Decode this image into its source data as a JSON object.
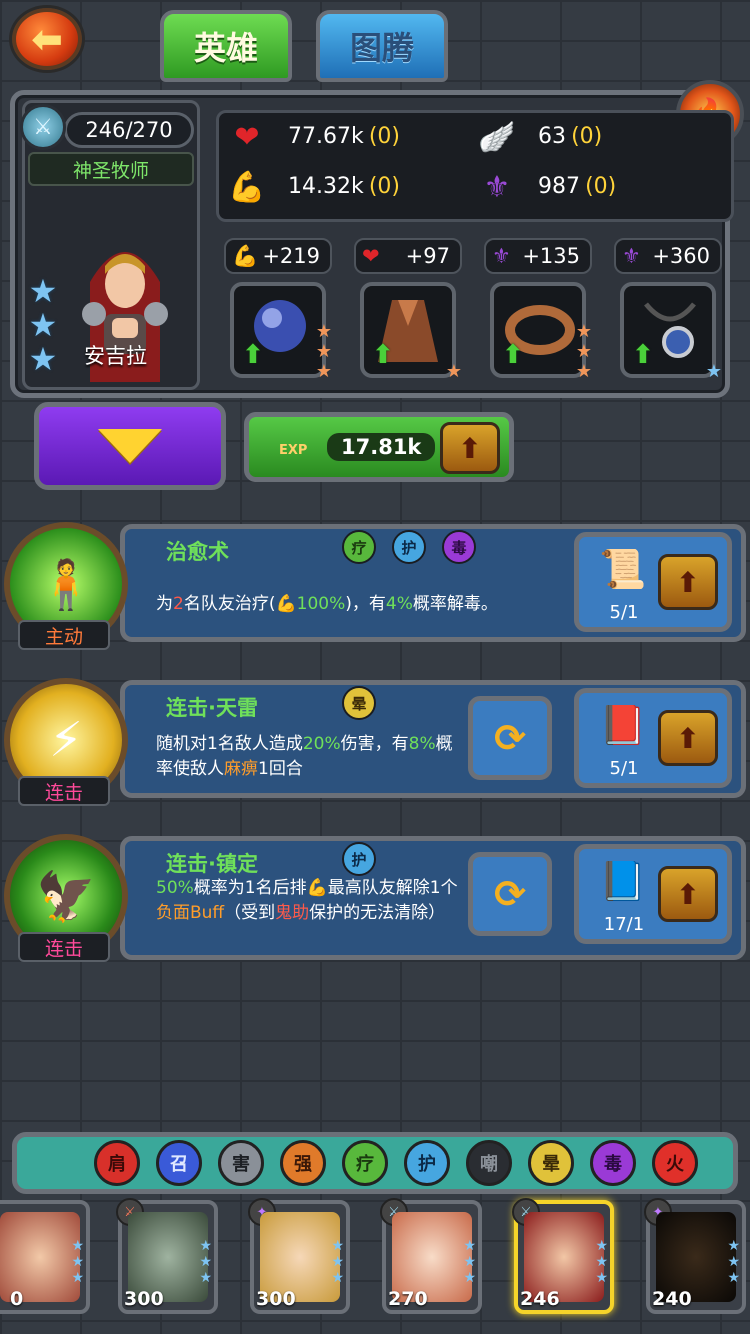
{
  "tabs": {
    "hero": "英雄",
    "totem": "图腾"
  },
  "hero": {
    "capacity": "246/270",
    "class": "神圣牧师",
    "name": "安吉拉",
    "stats": [
      {
        "icon": "heart-icon",
        "value": "77.67k",
        "delta": "(0)"
      },
      {
        "icon": "wing-icon",
        "value": "63",
        "delta": "(0)"
      },
      {
        "icon": "muscle-icon",
        "value": "14.32k",
        "delta": "(0)"
      },
      {
        "icon": "banner-icon",
        "value": "987",
        "delta": "(0)"
      }
    ],
    "bonuses": [
      "+219",
      "+97",
      "+135",
      "+360"
    ]
  },
  "exp": {
    "label": "EXP",
    "value": "17.81k"
  },
  "skills": [
    {
      "title": "治愈术",
      "type": "主动",
      "tags": [
        "疗",
        "护",
        "毒"
      ],
      "desc_parts": [
        "为",
        "2",
        "名队友治疗(",
        "100%",
        ")，有",
        "4%",
        "概率解毒。"
      ],
      "count": "5/1"
    },
    {
      "title": "连击·天雷",
      "type": "连击",
      "tags": [
        "晕"
      ],
      "desc_parts": [
        "随机对1名敌人造成",
        "20%",
        "伤害，有",
        "8%",
        "概率使敌人",
        "麻痹",
        "1回合"
      ],
      "count": "5/1"
    },
    {
      "title": "连击·镇定",
      "type": "连击",
      "tags": [
        "护"
      ],
      "desc_parts": [
        "50%",
        "概率为1名后排",
        "最高队友解除1个",
        "负面Buff",
        "（受到",
        "鬼助",
        "保护的无法清除）"
      ],
      "count": "17/1"
    }
  ],
  "filters": [
    "肩",
    "召",
    "害",
    "强",
    "疗",
    "护",
    "嘲",
    "晕",
    "毒",
    "火"
  ],
  "roster": [
    {
      "cap": "0"
    },
    {
      "cap": "300"
    },
    {
      "cap": "300"
    },
    {
      "cap": "270"
    },
    {
      "cap": "246"
    },
    {
      "cap": "240"
    }
  ]
}
